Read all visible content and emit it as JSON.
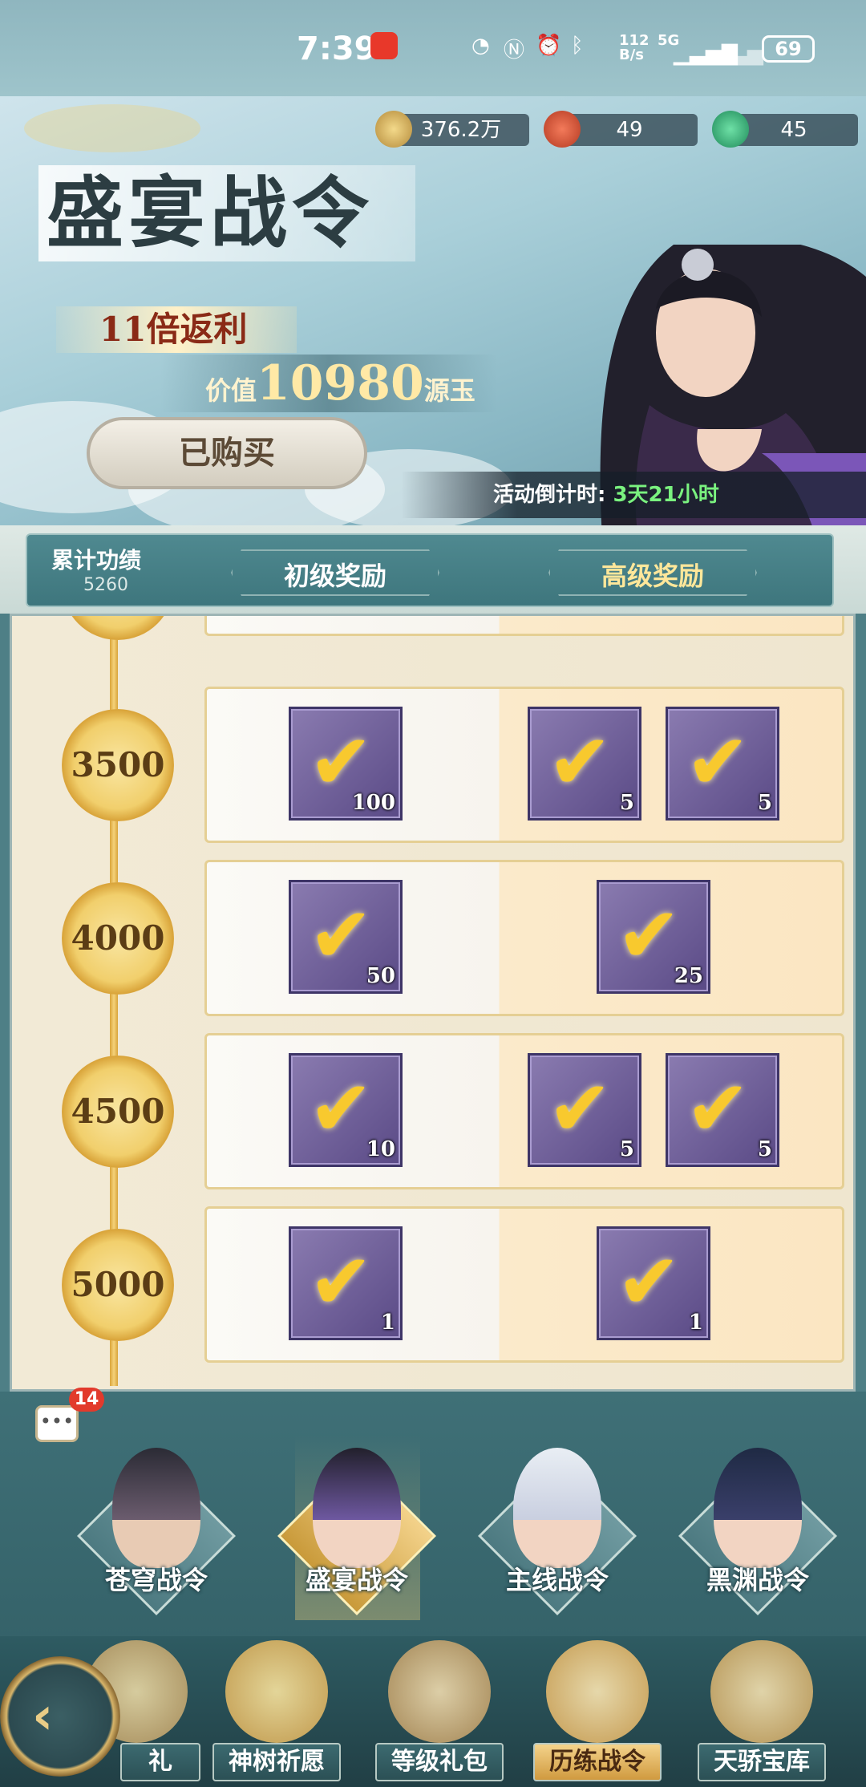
{
  "status_bar": {
    "time": "7:39",
    "net_speed": "112\nB/s",
    "network": "5G",
    "battery": "69"
  },
  "resources": [
    {
      "name": "coin",
      "value": "376.2万"
    },
    {
      "name": "red-gem",
      "value": "49"
    },
    {
      "name": "green-gem",
      "value": "45"
    }
  ],
  "banner": {
    "title": "盛宴战令",
    "rebate": "11倍返利",
    "value_prefix": "价值",
    "value_amount": "10980",
    "value_suffix": "源玉",
    "purchased_label": "已购买",
    "countdown_label": "活动倒计时:",
    "countdown_value": "3天21小时"
  },
  "tabs": {
    "merit_label": "累计功绩",
    "merit_value": "5260",
    "basic": "初级奖励",
    "advanced": "高级奖励"
  },
  "rows": [
    {
      "level": "3500",
      "basic": [
        {
          "qty": "100",
          "icon": "potion-icon"
        }
      ],
      "advanced": [
        {
          "qty": "5",
          "icon": "fish-icon"
        },
        {
          "qty": "5",
          "icon": "pepper-icon"
        }
      ]
    },
    {
      "level": "4000",
      "basic": [
        {
          "qty": "50",
          "icon": "crystal-icon"
        }
      ],
      "advanced": [
        {
          "qty": "25",
          "icon": "seed-icon"
        }
      ]
    },
    {
      "level": "4500",
      "basic": [
        {
          "qty": "10",
          "icon": "orb-icon"
        }
      ],
      "advanced": [
        {
          "qty": "5",
          "icon": "meat-icon"
        },
        {
          "qty": "5",
          "icon": "cloth-icon"
        }
      ]
    },
    {
      "level": "5000",
      "basic": [
        {
          "qty": "1",
          "icon": "chest-icon"
        }
      ],
      "advanced": [
        {
          "qty": "1",
          "icon": "chest-icon"
        }
      ]
    }
  ],
  "chat_badge": "14",
  "pass_tabs": [
    "苍穹战令",
    "盛宴战令",
    "主线战令",
    "黑渊战令"
  ],
  "nav": [
    "礼",
    "神树祈愿",
    "等级礼包",
    "历练战令",
    "天骄宝库"
  ],
  "colors": {
    "accent_gold": "#f1cf6c",
    "countdown_green": "#7af27f",
    "badge_red": "#e23a2c"
  }
}
